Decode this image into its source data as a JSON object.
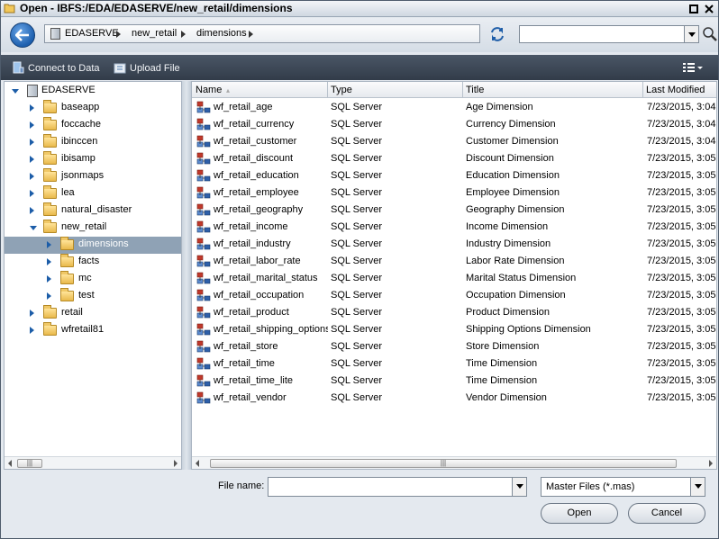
{
  "window": {
    "title": "Open - IBFS:/EDA/EDASERVE/new_retail/dimensions"
  },
  "navbar": {
    "breadcrumbs": [
      "EDASERVE",
      "new_retail",
      "dimensions"
    ],
    "search_value": ""
  },
  "toolbar": {
    "connect_label": "Connect to Data",
    "upload_label": "Upload File"
  },
  "tree": {
    "root": "EDASERVE",
    "items": [
      {
        "label": "baseapp",
        "level": 1,
        "expanded": false,
        "selected": false
      },
      {
        "label": "foccache",
        "level": 1,
        "expanded": false,
        "selected": false
      },
      {
        "label": "ibinccen",
        "level": 1,
        "expanded": false,
        "selected": false
      },
      {
        "label": "ibisamp",
        "level": 1,
        "expanded": false,
        "selected": false
      },
      {
        "label": "jsonmaps",
        "level": 1,
        "expanded": false,
        "selected": false
      },
      {
        "label": "lea",
        "level": 1,
        "expanded": false,
        "selected": false
      },
      {
        "label": "natural_disaster",
        "level": 1,
        "expanded": false,
        "selected": false
      },
      {
        "label": "new_retail",
        "level": 1,
        "expanded": true,
        "selected": false
      },
      {
        "label": "dimensions",
        "level": 2,
        "expanded": false,
        "selected": true
      },
      {
        "label": "facts",
        "level": 2,
        "expanded": false,
        "selected": false
      },
      {
        "label": "mc",
        "level": 2,
        "expanded": false,
        "selected": false
      },
      {
        "label": "test",
        "level": 2,
        "expanded": false,
        "selected": false
      },
      {
        "label": "retail",
        "level": 1,
        "expanded": false,
        "selected": false
      },
      {
        "label": "wfretail81",
        "level": 1,
        "expanded": false,
        "selected": false
      }
    ]
  },
  "columns": {
    "name": "Name",
    "type": "Type",
    "title": "Title",
    "modified": "Last Modified"
  },
  "files": [
    {
      "name": "wf_retail_age",
      "type": "SQL Server",
      "title": "Age Dimension",
      "modified": "7/23/2015, 3:04"
    },
    {
      "name": "wf_retail_currency",
      "type": "SQL Server",
      "title": "Currency Dimension",
      "modified": "7/23/2015, 3:04"
    },
    {
      "name": "wf_retail_customer",
      "type": "SQL Server",
      "title": "Customer Dimension",
      "modified": "7/23/2015, 3:04"
    },
    {
      "name": "wf_retail_discount",
      "type": "SQL Server",
      "title": "Discount Dimension",
      "modified": "7/23/2015, 3:05"
    },
    {
      "name": "wf_retail_education",
      "type": "SQL Server",
      "title": "Education Dimension",
      "modified": "7/23/2015, 3:05"
    },
    {
      "name": "wf_retail_employee",
      "type": "SQL Server",
      "title": "Employee Dimension",
      "modified": "7/23/2015, 3:05"
    },
    {
      "name": "wf_retail_geography",
      "type": "SQL Server",
      "title": "Geography Dimension",
      "modified": "7/23/2015, 3:05"
    },
    {
      "name": "wf_retail_income",
      "type": "SQL Server",
      "title": "Income Dimension",
      "modified": "7/23/2015, 3:05"
    },
    {
      "name": "wf_retail_industry",
      "type": "SQL Server",
      "title": "Industry Dimension",
      "modified": "7/23/2015, 3:05"
    },
    {
      "name": "wf_retail_labor_rate",
      "type": "SQL Server",
      "title": "Labor Rate Dimension",
      "modified": "7/23/2015, 3:05"
    },
    {
      "name": "wf_retail_marital_status",
      "type": "SQL Server",
      "title": "Marital Status Dimension",
      "modified": "7/23/2015, 3:05"
    },
    {
      "name": "wf_retail_occupation",
      "type": "SQL Server",
      "title": "Occupation Dimension",
      "modified": "7/23/2015, 3:05"
    },
    {
      "name": "wf_retail_product",
      "type": "SQL Server",
      "title": "Product Dimension",
      "modified": "7/23/2015, 3:05"
    },
    {
      "name": "wf_retail_shipping_options",
      "type": "SQL Server",
      "title": "Shipping Options Dimension",
      "modified": "7/23/2015, 3:05"
    },
    {
      "name": "wf_retail_store",
      "type": "SQL Server",
      "title": "Store Dimension",
      "modified": "7/23/2015, 3:05"
    },
    {
      "name": "wf_retail_time",
      "type": "SQL Server",
      "title": "Time Dimension",
      "modified": "7/23/2015, 3:05"
    },
    {
      "name": "wf_retail_time_lite",
      "type": "SQL Server",
      "title": "Time Dimension",
      "modified": "7/23/2015, 3:05"
    },
    {
      "name": "wf_retail_vendor",
      "type": "SQL Server",
      "title": "Vendor Dimension",
      "modified": "7/23/2015, 3:05"
    }
  ],
  "bottom": {
    "file_name_label": "File name:",
    "file_name_value": "",
    "file_type": "Master Files (*.mas)",
    "open_label": "Open",
    "cancel_label": "Cancel"
  },
  "colors": {
    "toolbar_bg": "#3d4856",
    "selection": "#8fa2b5",
    "folder": "#f0c867"
  },
  "icons": {
    "back": "back-arrow-icon",
    "refresh": "refresh-icon",
    "search": "magnifier-icon",
    "folder": "folder-icon",
    "master_file": "master-file-icon"
  }
}
